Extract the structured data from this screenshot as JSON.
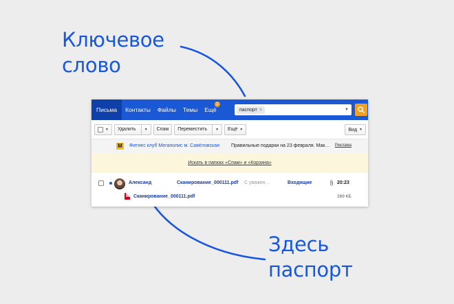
{
  "callouts": {
    "top_line1": "Ключевое",
    "top_line2": "слово",
    "bottom_line1": "Здесь",
    "bottom_line2": "паспорт"
  },
  "tabs": [
    {
      "label": "Письма",
      "active": true
    },
    {
      "label": "Контакты"
    },
    {
      "label": "Файлы"
    },
    {
      "label": "Темы"
    },
    {
      "label": "Ещё",
      "badge": "2"
    }
  ],
  "search": {
    "chip": "паспорт",
    "chip_remove": "×"
  },
  "toolbar": {
    "delete": "Удалить",
    "spam": "Спам",
    "move": "Переместить",
    "more": "Ещё",
    "view": "Вид"
  },
  "ad": {
    "logo": "M",
    "sender": "Фитнес клуб Мегаполис м. Савёловская",
    "subject": "Правильные подарки на 23 февраля. Мак…",
    "label": "Реклама"
  },
  "notice": "Искать в папках «Спам» и «Корзина»",
  "message": {
    "sender": "Александ",
    "subject": "Сканирование_000111.pdf",
    "snippet": "С уважен…",
    "folder": "Входящие",
    "time": "20:23",
    "attachment_name": "Сканирование_000111.pdf",
    "attachment_size": "269 КБ"
  },
  "colors": {
    "accent": "#1a58d6",
    "search_button": "#f2a024",
    "callout": "#1656e0"
  }
}
